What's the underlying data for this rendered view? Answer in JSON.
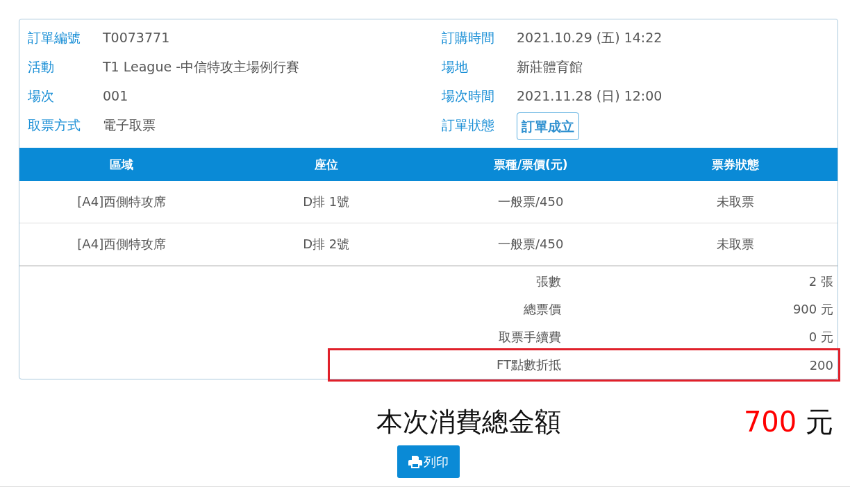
{
  "order_info": {
    "left": [
      {
        "label": "訂單編號",
        "value": "T0073771"
      },
      {
        "label": "活動",
        "value": "T1 League -中信特攻主場例行賽"
      },
      {
        "label": "場次",
        "value": "001"
      },
      {
        "label": "取票方式",
        "value": "電子取票"
      }
    ],
    "right": [
      {
        "label": "訂購時間",
        "value": "2021.10.29 (五) 14:22",
        "kind": "text"
      },
      {
        "label": "場地",
        "value": "新莊體育館",
        "kind": "text"
      },
      {
        "label": "場次時間",
        "value": "2021.11.28 (日) 12:00",
        "kind": "text"
      },
      {
        "label": "訂單狀態",
        "value": "訂單成立",
        "kind": "badge"
      }
    ]
  },
  "table": {
    "columns": [
      "區域",
      "座位",
      "票種/票價(元)",
      "票券狀態"
    ],
    "rows": [
      [
        "[A4]西側特攻席",
        "D排 1號",
        "一般票/450",
        "未取票"
      ],
      [
        "[A4]西側特攻席",
        "D排 2號",
        "一般票/450",
        "未取票"
      ]
    ]
  },
  "summary": [
    {
      "label": "張數",
      "value": "2 張",
      "highlighted": false
    },
    {
      "label": "總票價",
      "value": "900 元",
      "highlighted": false
    },
    {
      "label": "取票手續費",
      "value": "0 元",
      "highlighted": false
    },
    {
      "label": "FT點數折抵",
      "value": "200",
      "highlighted": true
    }
  ],
  "total": {
    "label": "本次消費總金額",
    "amount": "700",
    "unit": "元"
  },
  "print_button": {
    "label": "列印"
  }
}
